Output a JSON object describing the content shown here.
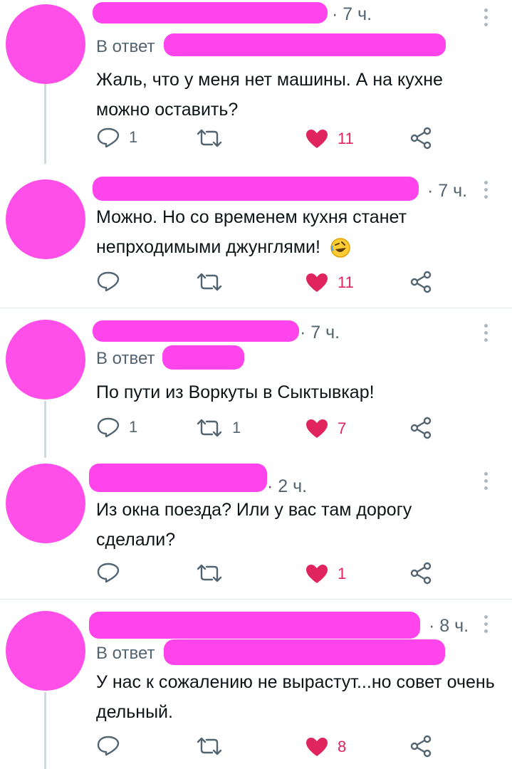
{
  "tweets": [
    {
      "time": "· 7 ч.",
      "reply_prefix": "В ответ",
      "text": "Жаль, что у меня нет машины. А на кухне можно оставить?",
      "replies": "1",
      "retweets": "",
      "likes": "11",
      "liked": true
    },
    {
      "time": "· 7 ч.",
      "reply_prefix": "",
      "text": "Можно. Но со временем кухня станет непрходимыми джунглями!",
      "emoji": "rolling-laughing-emoji",
      "replies": "",
      "retweets": "",
      "likes": "11",
      "liked": true
    },
    {
      "time": "· 7 ч.",
      "reply_prefix": "В ответ",
      "text": "По пути из Воркуты в Сыктывкар!",
      "replies": "1",
      "retweets": "1",
      "likes": "7",
      "liked": true
    },
    {
      "time": "· 2 ч.",
      "reply_prefix": "",
      "text": "Из окна поезда? Или у вас там дорогу сделали?",
      "replies": "",
      "retweets": "",
      "likes": "1",
      "liked": true
    },
    {
      "time": "· 8 ч.",
      "reply_prefix": "В ответ",
      "text": "У нас к сожалению не вырастут...но совет очень дельный.",
      "replies": "",
      "retweets": "",
      "likes": "8",
      "liked": true
    }
  ],
  "colors": {
    "like": "#e0245e",
    "muted": "#536471",
    "redaction": "#ff44ec"
  },
  "icons": [
    "reply-icon",
    "retweet-icon",
    "like-icon",
    "share-icon",
    "more-icon"
  ]
}
